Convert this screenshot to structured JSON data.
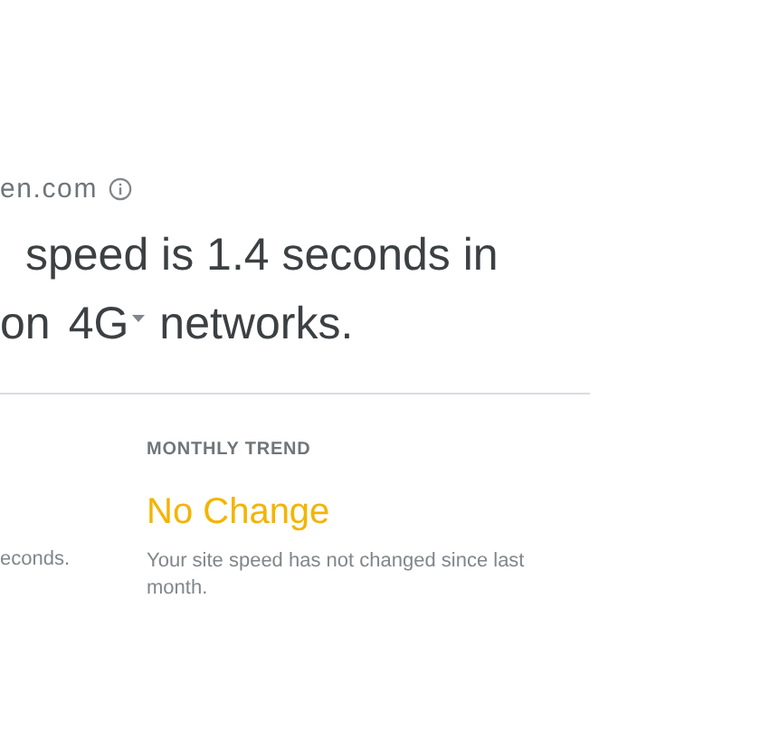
{
  "site": {
    "domain": "en.com"
  },
  "headline": {
    "line_1": "speed is 1.4 seconds in",
    "prefix": "on",
    "network": {
      "label": "4G"
    },
    "suffix": "networks."
  },
  "summary": {
    "text": "econds."
  },
  "monthly_trend": {
    "heading": "MONTHLY TREND",
    "status": "No Change",
    "color": "#f4b400",
    "description": "Your site speed has not changed since last month."
  }
}
